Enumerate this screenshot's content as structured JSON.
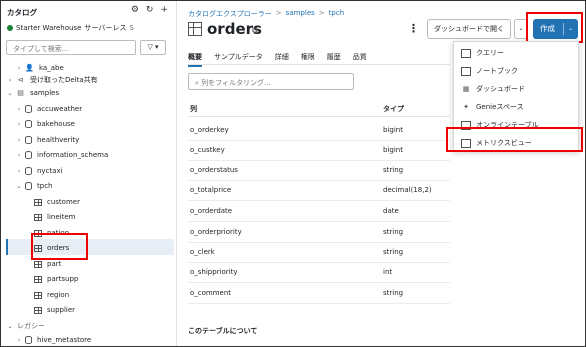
{
  "sidebar": {
    "title": "カタログ",
    "warehouse_name": "Starter Warehouse",
    "warehouse_type": "サーバーレス",
    "warehouse_suffix": "S",
    "search_placeholder": "タイプして検索...",
    "tree": [
      {
        "label": "ka_abe",
        "icon": "person-icon"
      },
      {
        "label": "受け取ったDelta共有",
        "icon": "share-icon"
      },
      {
        "label": "samples",
        "icon": "catalog-icon"
      },
      {
        "label": "accuweather",
        "icon": "database-icon"
      },
      {
        "label": "bakehouse",
        "icon": "database-icon"
      },
      {
        "label": "healthverity",
        "icon": "database-icon"
      },
      {
        "label": "information_schema",
        "icon": "database-icon"
      },
      {
        "label": "nyctaxi",
        "icon": "database-icon"
      },
      {
        "label": "tpch",
        "icon": "database-icon"
      },
      {
        "label": "customer",
        "icon": "table-icon"
      },
      {
        "label": "lineitem",
        "icon": "table-icon"
      },
      {
        "label": "nation",
        "icon": "table-icon"
      },
      {
        "label": "orders",
        "icon": "table-icon"
      },
      {
        "label": "part",
        "icon": "table-icon"
      },
      {
        "label": "partsupp",
        "icon": "table-icon"
      },
      {
        "label": "region",
        "icon": "table-icon"
      },
      {
        "label": "supplier",
        "icon": "table-icon"
      },
      {
        "label": "レガシー",
        "icon": ""
      },
      {
        "label": "hive_metastore",
        "icon": "database-icon"
      }
    ]
  },
  "breadcrumb": [
    "カタログエクスプローラー",
    "samples",
    "tpch"
  ],
  "page": {
    "title": "orders",
    "dashboard_button": "ダッシュボードで開く",
    "create_button": "作成"
  },
  "tabs": [
    "概要",
    "サンプルデータ",
    "詳細",
    "権限",
    "履歴",
    "品質"
  ],
  "filter_placeholder": "列をフィルタリング...",
  "table": {
    "headers": [
      "列",
      "タイプ"
    ],
    "rows": [
      [
        "o_orderkey",
        "bigint"
      ],
      [
        "o_custkey",
        "bigint"
      ],
      [
        "o_orderstatus",
        "string"
      ],
      [
        "o_totalprice",
        "decimal(18,2)"
      ],
      [
        "o_orderdate",
        "date"
      ],
      [
        "o_orderpriority",
        "string"
      ],
      [
        "o_clerk",
        "string"
      ],
      [
        "o_shippriority",
        "int"
      ],
      [
        "o_comment",
        "string"
      ]
    ]
  },
  "about_heading": "このテーブルについて",
  "create_menu": [
    {
      "label": "クエリー",
      "icon": "query-icon"
    },
    {
      "label": "ノートブック",
      "icon": "notebook-icon"
    },
    {
      "label": "ダッシュボード",
      "icon": "dashboard-icon"
    },
    {
      "label": "Genieスペース",
      "icon": "genie-icon"
    },
    {
      "label": "オンラインテーブル",
      "icon": "online-table-icon"
    },
    {
      "label": "メトリクスビュー",
      "icon": "metric-view-icon"
    }
  ],
  "colors": {
    "accent": "#2272b4",
    "highlight_box": "#e00000",
    "selected_row": "#e8eef6"
  }
}
